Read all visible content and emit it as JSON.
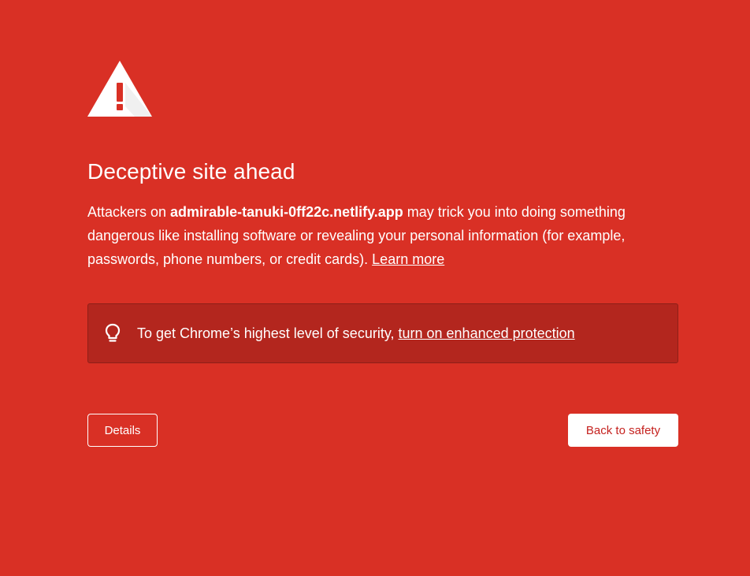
{
  "icons": {
    "warning": "warning-triangle-icon",
    "tip": "lightbulb-icon"
  },
  "colors": {
    "background": "#d93025",
    "tip_box": "#b3261e",
    "safety_button_text": "#c5221f"
  },
  "interstitial": {
    "title": "Deceptive site ahead",
    "body_prefix": "Attackers on ",
    "domain": "admirable-tanuki-0ff22c.netlify.app",
    "body_suffix": " may trick you into doing something dangerous like installing software or revealing your personal information (for example, passwords, phone numbers, or credit cards). ",
    "learn_more": "Learn more",
    "tip_text": "To get Chrome’s highest level of security, ",
    "tip_link": "turn on enhanced protection",
    "details_button": "Details",
    "back_button": "Back to safety"
  }
}
